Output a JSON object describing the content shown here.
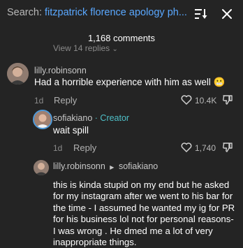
{
  "search": {
    "prefix": "Search: ",
    "query": "fitzpatrick florence apology ph..."
  },
  "comments_header": {
    "count_label": "1,168 comments"
  },
  "view_replies_label": "View 14 replies",
  "comments": [
    {
      "username": "lilly.robinsonn",
      "text": "Had a horrible experience with him as well 😬",
      "age": "1d",
      "reply_label": "Reply",
      "likes": "10.4K"
    },
    {
      "username": "sofiakiano",
      "badge": "· Creator",
      "text": "wait spill",
      "age": "1d",
      "reply_label": "Reply",
      "likes": "1,740"
    },
    {
      "username": "lilly.robinsonn",
      "reply_to": "sofiakiano",
      "text": "this is kinda stupid on my end but he asked for my instagram after we went to his bar for the time - I assumed he wanted my ig for PR for his business lol not for personal reasons- I was wrong . He dmed me a lot of very inappropriate things."
    }
  ],
  "colors": {
    "background": "#242424",
    "link_blue": "#5aa8ff",
    "creator_teal": "#4fc0c8",
    "highlight_ring": "#4f9ad9"
  },
  "icons": [
    "sort-icon",
    "close-icon",
    "chevron-down-icon",
    "heart-icon",
    "dislike-icon",
    "reply-arrow-icon",
    "grimace-emoji"
  ]
}
